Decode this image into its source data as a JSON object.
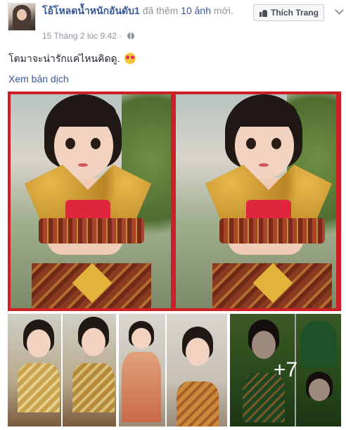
{
  "post": {
    "page_name": "โอ้โหลดน้ำหนักอันดับ1",
    "action_prefix": "đã thêm",
    "photo_count": "10 ảnh",
    "action_suffix": "mới.",
    "timestamp": "15 Tháng 2 lúc 9:42",
    "like_button": "Thích Trang",
    "caption": "โตมาจะน่ารักแค่ไหนคิดดู.",
    "translate_link": "Xem bản dịch",
    "more_photos": "+7"
  },
  "icons": {
    "privacy": "globe-icon",
    "like": "thumbs-up-icon",
    "menu": "chevron-down-icon",
    "emoji": "heart-eyes-emoji"
  },
  "colors": {
    "link": "#365899",
    "meta": "#90949c",
    "photo_border": "#cc1f26"
  }
}
